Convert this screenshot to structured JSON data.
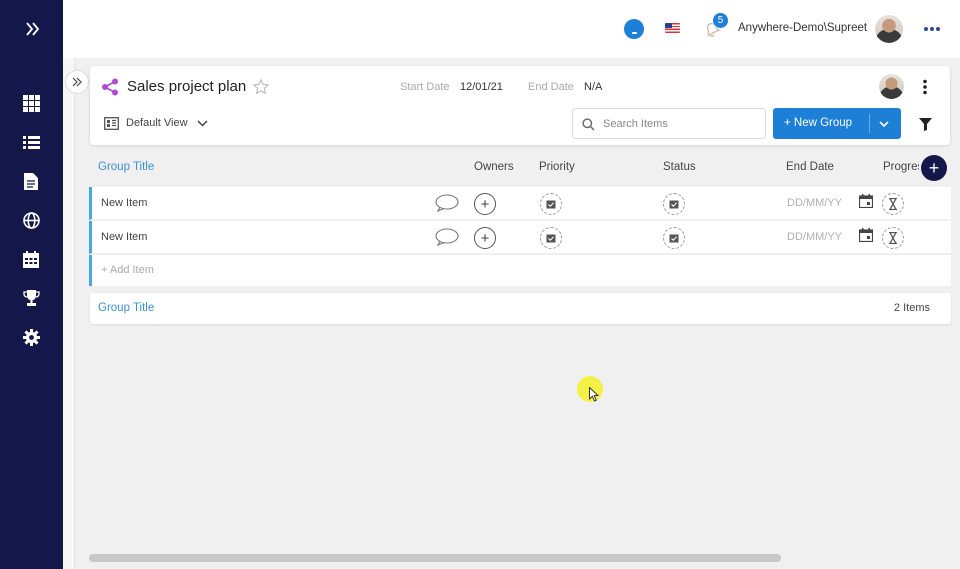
{
  "topbar": {
    "notification_count": "5",
    "user_name": "Anywhere-Demo\\Supreet"
  },
  "sidebar": {
    "items": [
      {
        "icon": "grid-icon"
      },
      {
        "icon": "list-icon"
      },
      {
        "icon": "document-icon"
      },
      {
        "icon": "globe-icon"
      },
      {
        "icon": "calendar-icon"
      },
      {
        "icon": "trophy-icon"
      },
      {
        "icon": "gear-icon"
      }
    ]
  },
  "project": {
    "title": "Sales project plan",
    "start_label": "Start Date",
    "start_value": "12/01/21",
    "end_label": "End Date",
    "end_value": "N/A",
    "view_label": "Default View"
  },
  "search": {
    "placeholder": "Search Items"
  },
  "toolbar": {
    "new_group_label": "+ New Group"
  },
  "columns": {
    "group_title": "Group Title",
    "owners": "Owners",
    "priority": "Priority",
    "status": "Status",
    "end_date": "End Date",
    "progress": "Progres"
  },
  "rows": [
    {
      "name": "New Item",
      "date_placeholder": "DD/MM/YY"
    },
    {
      "name": "New Item",
      "date_placeholder": "DD/MM/YY"
    }
  ],
  "add_item_label": "+ Add Item",
  "group2": {
    "title": "Group Title",
    "count": "2 Items"
  },
  "colors": {
    "sidebar_bg": "#14174a",
    "accent": "#1e7fd6",
    "group_link": "#3d8fd8",
    "share_icon": "#b04bd6"
  }
}
